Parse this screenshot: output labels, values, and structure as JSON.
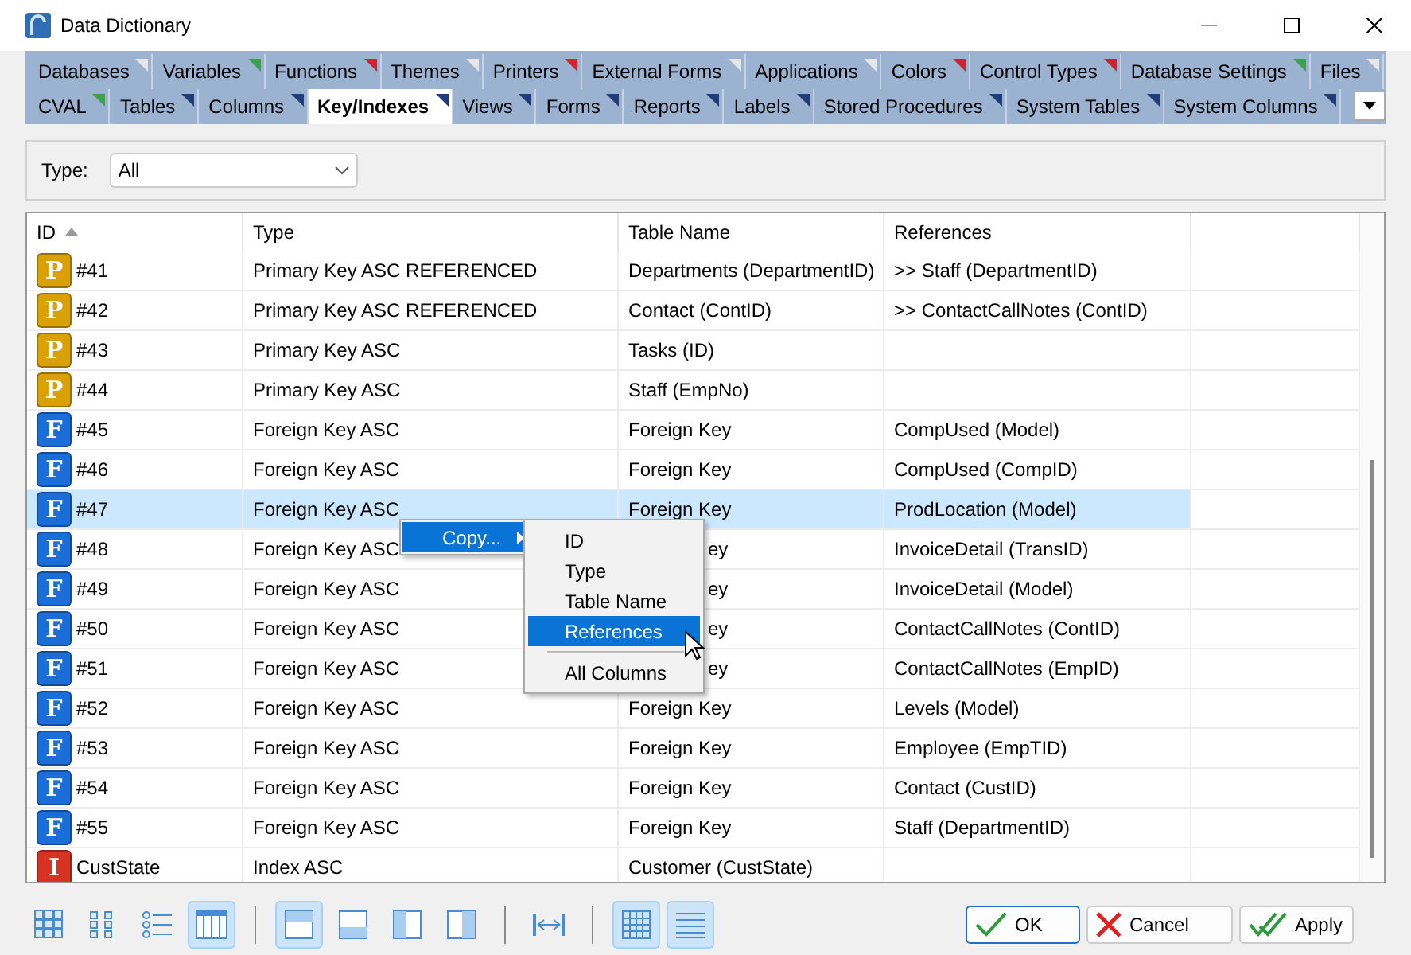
{
  "window": {
    "title": "Data Dictionary"
  },
  "tab_rows": [
    [
      {
        "label": "Databases",
        "color": "#e6e6e6",
        "selected": false
      },
      {
        "label": "Variables",
        "color": "#3aa346",
        "selected": false
      },
      {
        "label": "Functions",
        "color": "#d8202a",
        "selected": false
      },
      {
        "label": "Themes",
        "color": "#e6e6e6",
        "selected": false
      },
      {
        "label": "Printers",
        "color": "#d8202a",
        "selected": false
      },
      {
        "label": "External Forms",
        "color": "#e6e6e6",
        "selected": false
      },
      {
        "label": "Applications",
        "color": "#e6e6e6",
        "selected": false
      },
      {
        "label": "Colors",
        "color": "#d8202a",
        "selected": false
      },
      {
        "label": "Control Types",
        "color": "#d8202a",
        "selected": false
      },
      {
        "label": "Database Settings",
        "color": "#3aa346",
        "selected": false
      },
      {
        "label": "Files",
        "color": "#e6e6e6",
        "selected": false
      }
    ],
    [
      {
        "label": "CVAL",
        "color": "#3aa346",
        "selected": false
      },
      {
        "label": "Tables",
        "color": "#1f3d7a",
        "selected": false
      },
      {
        "label": "Columns",
        "color": "#1f3d7a",
        "selected": false
      },
      {
        "label": "Key/Indexes",
        "color": "#1f3d7a",
        "selected": true
      },
      {
        "label": "Views",
        "color": "#1f3d7a",
        "selected": false
      },
      {
        "label": "Forms",
        "color": "#1f3d7a",
        "selected": false
      },
      {
        "label": "Reports",
        "color": "#1f3d7a",
        "selected": false
      },
      {
        "label": "Labels",
        "color": "#1f3d7a",
        "selected": false
      },
      {
        "label": "Stored Procedures",
        "color": "#1f3d7a",
        "selected": false
      },
      {
        "label": "System Tables",
        "color": "#1f3d7a",
        "selected": false
      },
      {
        "label": "System Columns",
        "color": "#1f3d7a",
        "selected": false
      }
    ]
  ],
  "filter": {
    "label": "Type:",
    "value": "All"
  },
  "table": {
    "columns": [
      "ID",
      "Type",
      "Table Name",
      "References"
    ],
    "rows": [
      {
        "kind": "primary",
        "badge": "P",
        "id": "#41",
        "type": "Primary Key ASC REFERENCED",
        "table_name": "Departments (DepartmentID)",
        "references": ">> Staff (DepartmentID)",
        "selected": false
      },
      {
        "kind": "primary",
        "badge": "P",
        "id": "#42",
        "type": "Primary Key ASC REFERENCED",
        "table_name": "Contact (ContID)",
        "references": ">> ContactCallNotes (ContID)",
        "selected": false
      },
      {
        "kind": "primary",
        "badge": "P",
        "id": "#43",
        "type": "Primary Key ASC",
        "table_name": "Tasks (ID)",
        "references": "",
        "selected": false
      },
      {
        "kind": "primary",
        "badge": "P",
        "id": "#44",
        "type": "Primary Key ASC",
        "table_name": "Staff (EmpNo)",
        "references": "",
        "selected": false
      },
      {
        "kind": "foreign",
        "badge": "F",
        "id": "#45",
        "type": "Foreign Key ASC",
        "table_name": "Foreign Key",
        "references": "CompUsed (Model)",
        "selected": false
      },
      {
        "kind": "foreign",
        "badge": "F",
        "id": "#46",
        "type": "Foreign Key ASC",
        "table_name": "Foreign Key",
        "references": "CompUsed (CompID)",
        "selected": false
      },
      {
        "kind": "foreign",
        "badge": "F",
        "id": "#47",
        "type": "Foreign Key ASC",
        "table_name": "Foreign Key",
        "references": "ProdLocation (Model)",
        "selected": true
      },
      {
        "kind": "foreign",
        "badge": "F",
        "id": "#48",
        "type": "Foreign Key ASC",
        "table_name": "ey",
        "references": "InvoiceDetail (TransID)",
        "selected": false
      },
      {
        "kind": "foreign",
        "badge": "F",
        "id": "#49",
        "type": "Foreign Key ASC",
        "table_name": "ey",
        "references": "InvoiceDetail (Model)",
        "selected": false
      },
      {
        "kind": "foreign",
        "badge": "F",
        "id": "#50",
        "type": "Foreign Key ASC",
        "table_name": "ey",
        "references": "ContactCallNotes (ContID)",
        "selected": false
      },
      {
        "kind": "foreign",
        "badge": "F",
        "id": "#51",
        "type": "Foreign Key ASC",
        "table_name": "ey",
        "references": "ContactCallNotes (EmpID)",
        "selected": false
      },
      {
        "kind": "foreign",
        "badge": "F",
        "id": "#52",
        "type": "Foreign Key ASC",
        "table_name": "Foreign Key",
        "references": "Levels (Model)",
        "selected": false
      },
      {
        "kind": "foreign",
        "badge": "F",
        "id": "#53",
        "type": "Foreign Key ASC",
        "table_name": "Foreign Key",
        "references": "Employee (EmpTID)",
        "selected": false
      },
      {
        "kind": "foreign",
        "badge": "F",
        "id": "#54",
        "type": "Foreign Key ASC",
        "table_name": "Foreign Key",
        "references": "Contact (CustID)",
        "selected": false
      },
      {
        "kind": "foreign",
        "badge": "F",
        "id": "#55",
        "type": "Foreign Key ASC",
        "table_name": "Foreign Key",
        "references": "Staff (DepartmentID)",
        "selected": false
      },
      {
        "kind": "index",
        "badge": "I",
        "id": "CustState",
        "type": "Index ASC",
        "table_name": "Customer (CustState)",
        "references": "",
        "selected": false
      }
    ]
  },
  "context_menu": {
    "label": "Copy...",
    "submenu": [
      {
        "label": "ID",
        "selected": false
      },
      {
        "label": "Type",
        "selected": false
      },
      {
        "label": "Table Name",
        "selected": false
      },
      {
        "label": "References",
        "selected": true
      },
      {
        "label": "All Columns",
        "selected": false
      }
    ]
  },
  "toolbar": [
    {
      "kind": "large-icons",
      "on": false
    },
    {
      "kind": "small-icons",
      "on": false
    },
    {
      "kind": "list",
      "on": false
    },
    {
      "kind": "details",
      "on": true
    },
    {
      "kind": "sep"
    },
    {
      "kind": "layout-top",
      "on": true
    },
    {
      "kind": "layout-bottom",
      "on": false
    },
    {
      "kind": "layout-left",
      "on": false
    },
    {
      "kind": "layout-right",
      "on": false
    },
    {
      "kind": "sep"
    },
    {
      "kind": "fit-width",
      "on": false
    },
    {
      "kind": "sep"
    },
    {
      "kind": "grid-lines",
      "on": true
    },
    {
      "kind": "row-lines",
      "on": true
    }
  ],
  "buttons": [
    {
      "kind": "ok",
      "label": "OK"
    },
    {
      "kind": "cancel",
      "label": "Cancel"
    },
    {
      "kind": "apply",
      "label": "Apply"
    }
  ]
}
